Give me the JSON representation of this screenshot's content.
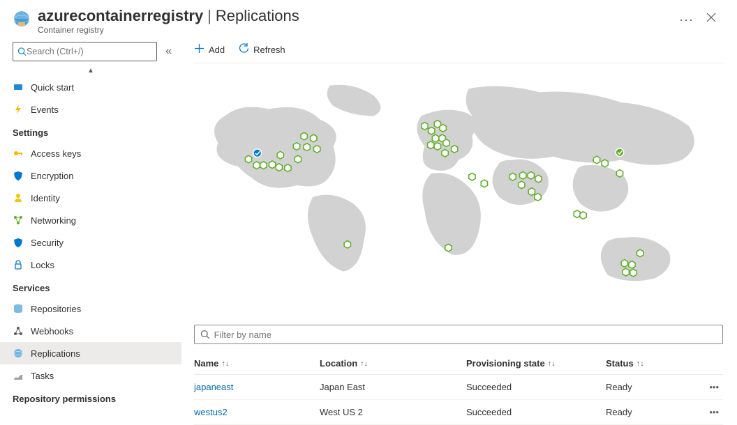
{
  "header": {
    "resource_name": "azurecontainerregistry",
    "page_title": "Replications",
    "subtitle": "Container registry"
  },
  "sidebar": {
    "search_placeholder": "Search (Ctrl+/)",
    "top_items": [
      {
        "label": "Quick start",
        "icon": "launcher"
      },
      {
        "label": "Events",
        "icon": "lightning"
      }
    ],
    "sections": [
      {
        "title": "Settings",
        "items": [
          {
            "label": "Access keys",
            "icon": "key"
          },
          {
            "label": "Encryption",
            "icon": "shield"
          },
          {
            "label": "Identity",
            "icon": "identity"
          },
          {
            "label": "Networking",
            "icon": "network"
          },
          {
            "label": "Security",
            "icon": "shield2"
          },
          {
            "label": "Locks",
            "icon": "lock"
          }
        ]
      },
      {
        "title": "Services",
        "items": [
          {
            "label": "Repositories",
            "icon": "repo"
          },
          {
            "label": "Webhooks",
            "icon": "webhook"
          },
          {
            "label": "Replications",
            "icon": "globe",
            "selected": true
          },
          {
            "label": "Tasks",
            "icon": "tasks"
          }
        ]
      },
      {
        "title": "Repository permissions",
        "items": []
      }
    ]
  },
  "toolbar": {
    "add_label": "Add",
    "refresh_label": "Refresh"
  },
  "filter": {
    "placeholder": "Filter by name"
  },
  "table": {
    "headers": {
      "name": "Name",
      "location": "Location",
      "provisioning": "Provisioning state",
      "status": "Status"
    },
    "rows": [
      {
        "name": "japaneast",
        "location": "Japan East",
        "provisioning": "Succeeded",
        "status": "Ready"
      },
      {
        "name": "westus2",
        "location": "West US 2",
        "provisioning": "Succeeded",
        "status": "Ready"
      }
    ]
  }
}
